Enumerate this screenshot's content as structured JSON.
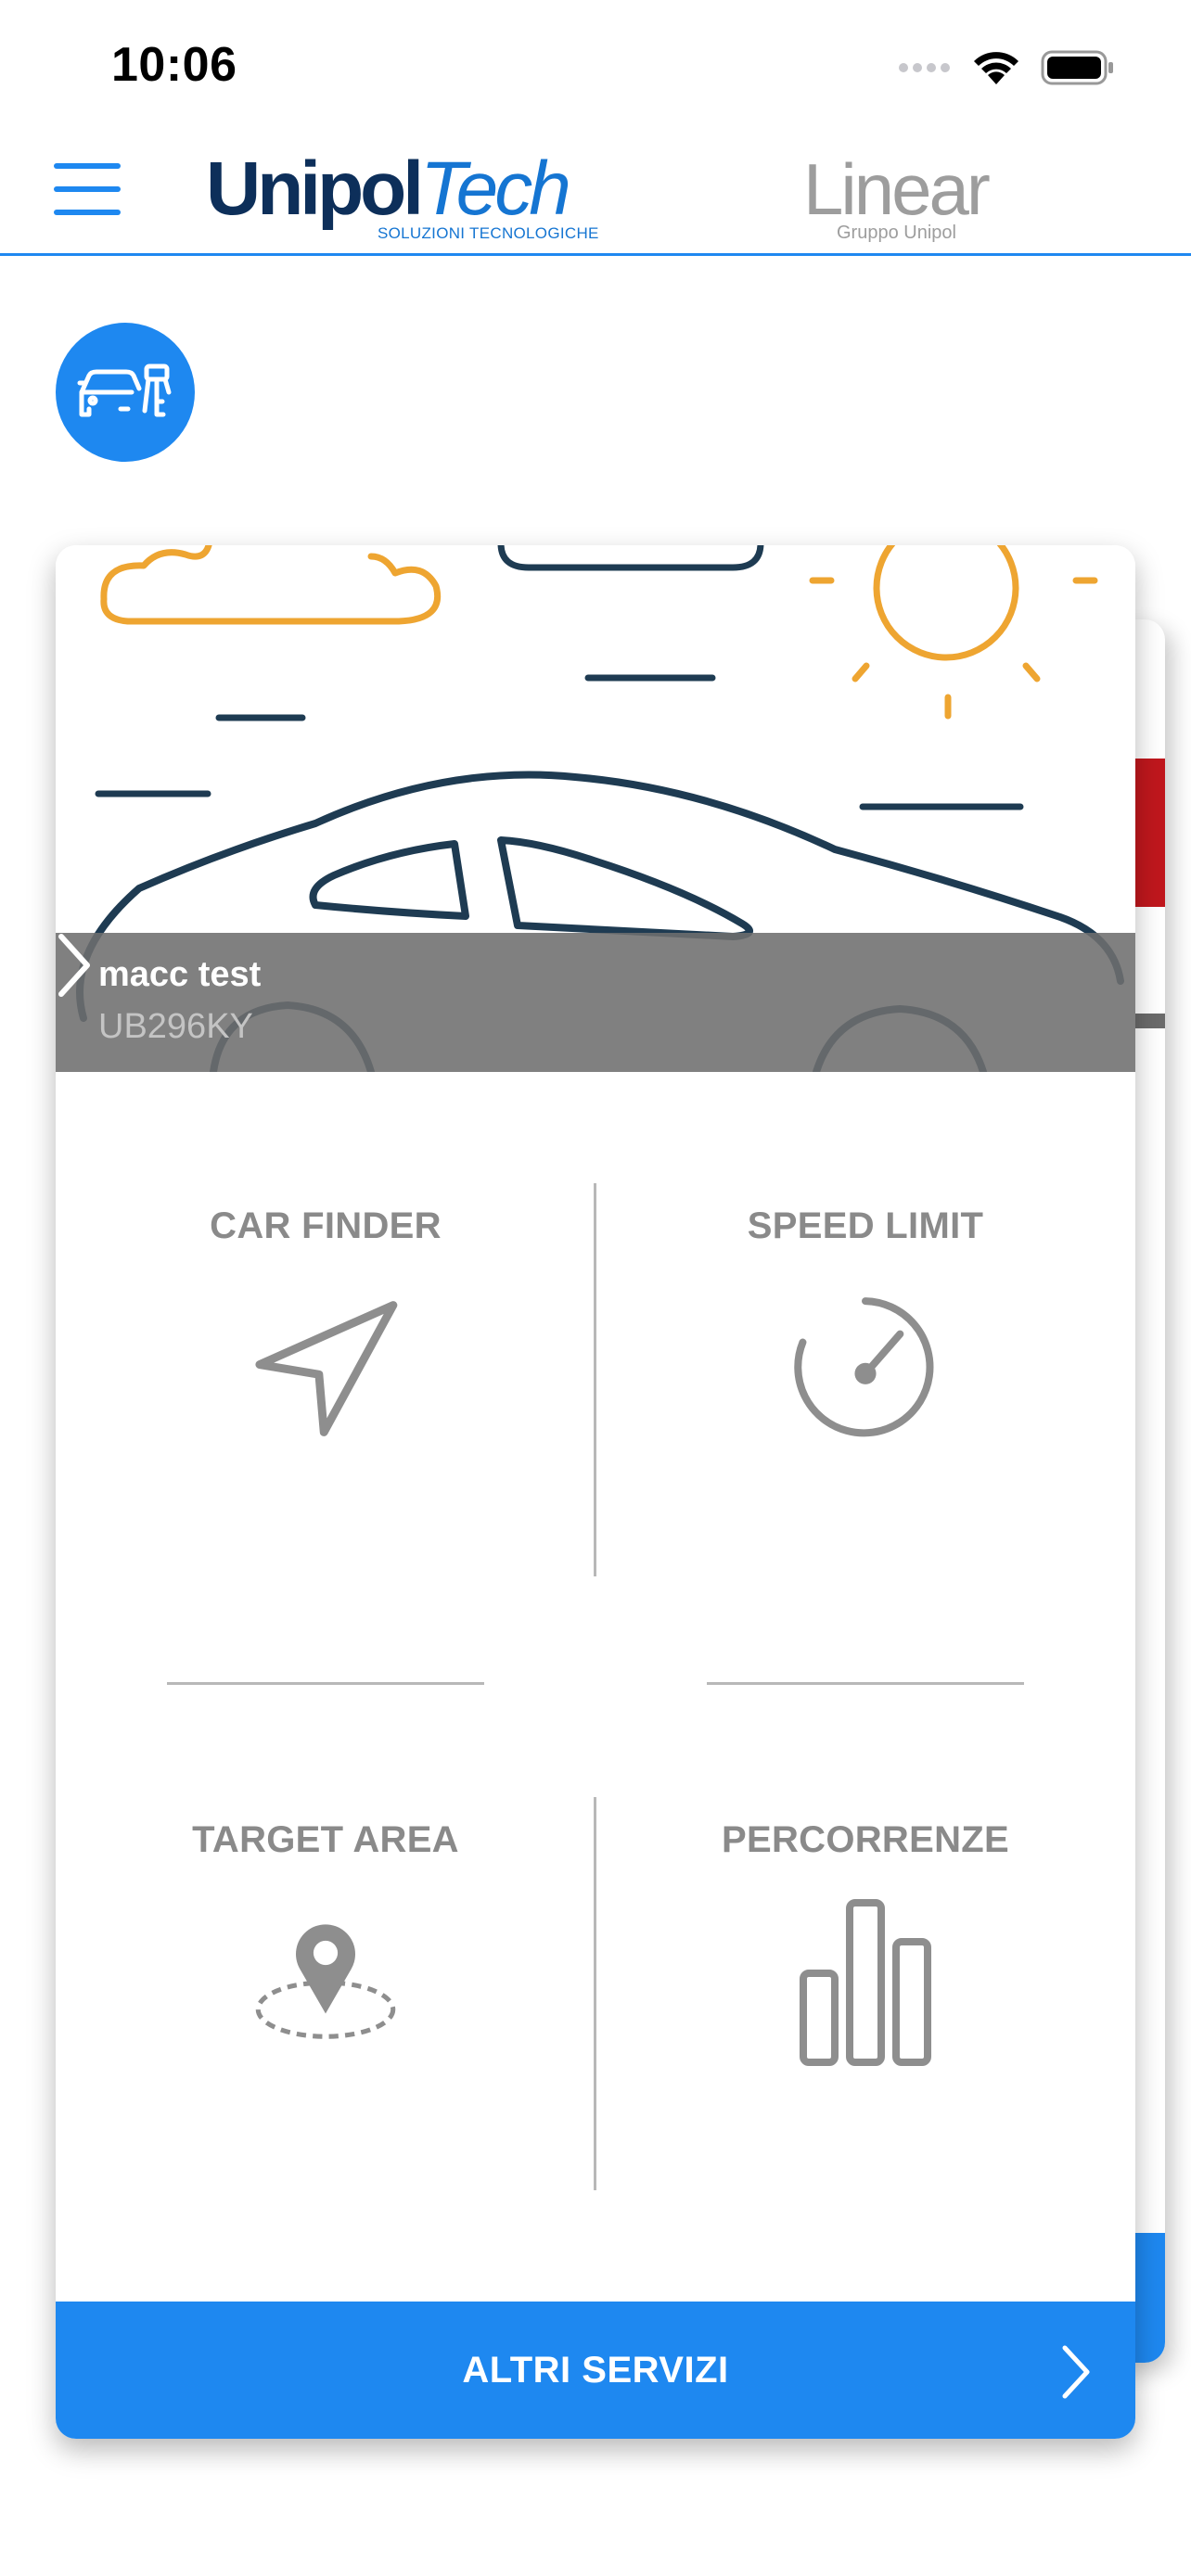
{
  "status_bar": {
    "time": "10:06",
    "icons": [
      "cellular-signal-icon",
      "wifi-icon",
      "battery-icon"
    ]
  },
  "header": {
    "menu_icon": "hamburger-menu-icon",
    "logo_left": {
      "word1": "Unipol",
      "word2": "Tech",
      "tagline": "SOLUZIONI TECNOLOGICHE"
    },
    "logo_right": {
      "word": "Linear",
      "subtitle": "Gruppo Unipol"
    }
  },
  "vehicle": {
    "name": "macc test",
    "plate": "UB296KY"
  },
  "services": [
    {
      "label": "CAR FINDER",
      "icon": "navigation-arrow-icon"
    },
    {
      "label": "SPEED LIMIT",
      "icon": "speedometer-icon"
    },
    {
      "label": "TARGET AREA",
      "icon": "map-pin-area-icon"
    },
    {
      "label": "PERCORRENZE",
      "icon": "bar-chart-icon"
    }
  ],
  "footer_button": {
    "label": "ALTRI SERVIZI"
  },
  "colors": {
    "accent": "#1e88f0",
    "label_gray": "#8a8a8a",
    "icon_gray": "#8e8e8e",
    "car_outline": "#1e3b52",
    "sun_cloud": "#eea531"
  }
}
